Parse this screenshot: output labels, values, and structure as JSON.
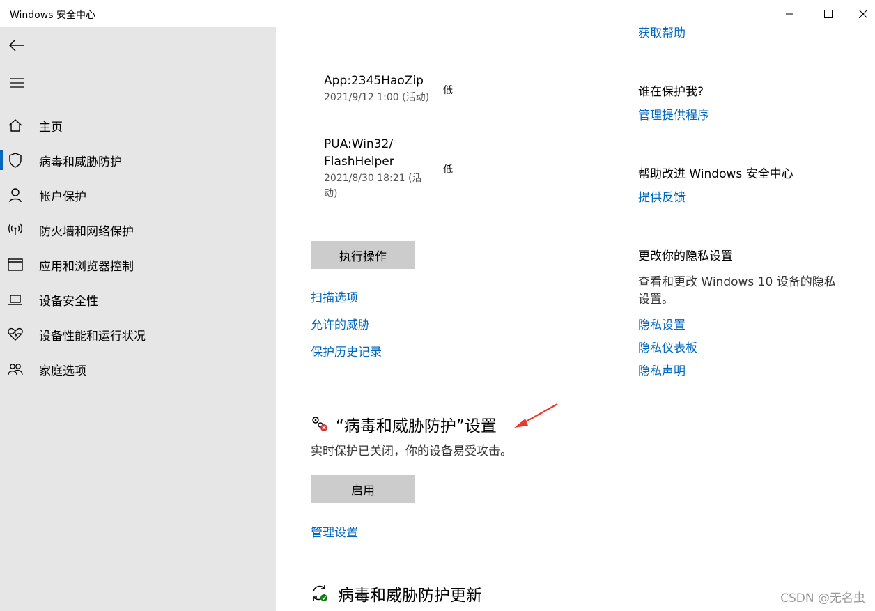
{
  "window": {
    "title": "Windows 安全中心"
  },
  "sidebar": {
    "items": [
      {
        "label": "主页",
        "icon": "home-icon"
      },
      {
        "label": "病毒和威胁防护",
        "icon": "shield-icon",
        "active": true
      },
      {
        "label": "帐户保护",
        "icon": "person-icon"
      },
      {
        "label": "防火墙和网络保护",
        "icon": "wireless-icon"
      },
      {
        "label": "应用和浏览器控制",
        "icon": "browser-window-icon"
      },
      {
        "label": "设备安全性",
        "icon": "laptop-icon"
      },
      {
        "label": "设备性能和运行状况",
        "icon": "heart-pulse-icon"
      },
      {
        "label": "家庭选项",
        "icon": "family-icon"
      }
    ]
  },
  "threats": [
    {
      "name": "App:2345HaoZip",
      "date": "2021/9/12 1:00 (活动)",
      "level": "低"
    },
    {
      "name_line1": "PUA:Win32/",
      "name_line2": "FlashHelper",
      "date_line1": "2021/8/30 18:21 (活",
      "date_line2": "动)",
      "level": "低"
    }
  ],
  "actions": {
    "execute_button": "执行操作",
    "links": [
      "扫描选项",
      "允许的威胁",
      "保护历史记录"
    ]
  },
  "settings_section": {
    "title": "“病毒和威胁防护”设置",
    "status": "实时保护已关闭，你的设备易受攻击。",
    "enable_button": "启用",
    "manage_link": "管理设置"
  },
  "updates_section": {
    "title": "病毒和威胁防护更新"
  },
  "right_panel": {
    "help_link": "获取帮助",
    "who_protects": {
      "heading": "谁在保护我?",
      "link": "管理提供程序"
    },
    "improve": {
      "heading": "帮助改进 Windows 安全中心",
      "link": "提供反馈"
    },
    "privacy": {
      "heading": "更改你的隐私设置",
      "desc_line1": "查看和更改 Windows 10 设备的隐私",
      "desc_line2": "设置。",
      "links": [
        "隐私设置",
        "隐私仪表板",
        "隐私声明"
      ]
    }
  },
  "watermark": "CSDN @无名虫",
  "colors": {
    "accent": "#0067c0",
    "sidebar_bg": "#e6e6e6",
    "button_bg": "#cccccc",
    "annotation_arrow": "#e8392b",
    "error_badge": "#d13438",
    "ok_badge": "#107c10"
  }
}
